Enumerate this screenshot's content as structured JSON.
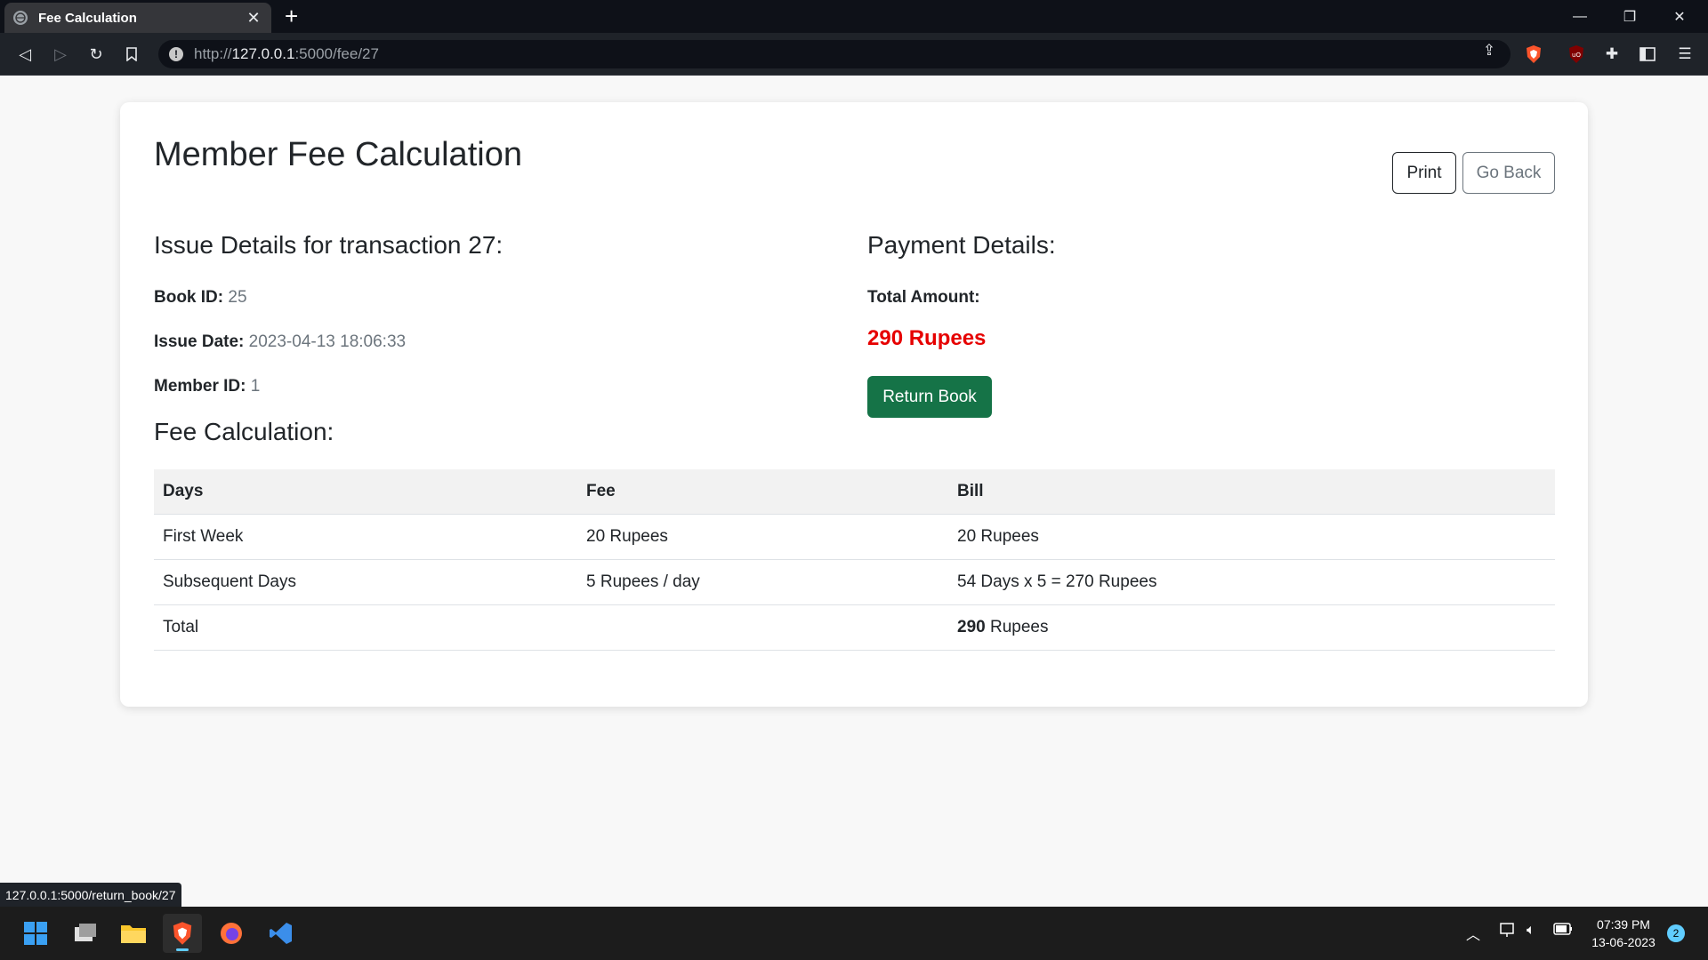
{
  "browser": {
    "tab_title": "Fee Calculation",
    "new_tab": "+",
    "url_prefix": "http://",
    "url_host": "127.0.0.1",
    "url_path": ":5000/fee/27"
  },
  "page": {
    "title": "Member Fee Calculation",
    "print_label": "Print",
    "back_label": "Go Back"
  },
  "issue": {
    "heading": "Issue Details for transaction 27:",
    "book_id_label": "Book ID:",
    "book_id": "25",
    "issue_date_label": "Issue Date:",
    "issue_date": "2023-04-13 18:06:33",
    "member_id_label": "Member ID:",
    "member_id": "1"
  },
  "payment": {
    "heading": "Payment Details:",
    "total_label": "Total Amount:",
    "total_amount": "290 Rupees",
    "return_label": "Return Book",
    "amount_color": "#e60000",
    "button_color": "#157347"
  },
  "fee": {
    "heading": "Fee Calculation:",
    "headers": [
      "Days",
      "Fee",
      "Bill"
    ],
    "rows": [
      [
        "First Week",
        "20 Rupees",
        "20 Rupees"
      ],
      [
        "Subsequent Days",
        "5 Rupees / day",
        "54 Days x 5 = 270 Rupees"
      ]
    ],
    "total_label": "Total",
    "total_value": "290",
    "total_unit": " Rupees"
  },
  "status_url": "127.0.0.1:5000/return_book/27",
  "taskbar": {
    "time": "07:39 PM",
    "date": "13-06-2023",
    "notifications": "2"
  }
}
